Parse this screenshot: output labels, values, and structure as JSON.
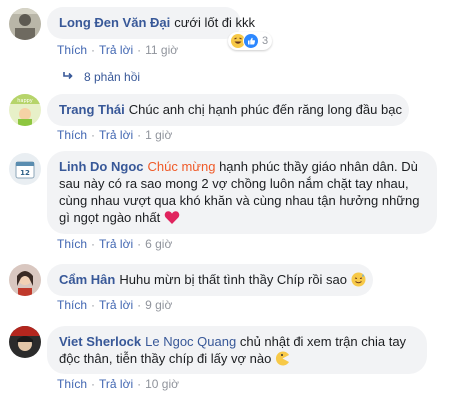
{
  "comments": [
    {
      "author": "Long Đen Văn Đại",
      "segments": [
        {
          "text": "cưới lốt đi kkk",
          "type": "plain"
        }
      ],
      "actions": {
        "like": "Thích",
        "reply": "Trả lời",
        "time": "11 giờ"
      },
      "reactions": {
        "count": "3",
        "icons": [
          "haha-icon",
          "like-icon"
        ]
      },
      "replies_label": "8 phản hồi"
    },
    {
      "author": "Trang Thái",
      "segments": [
        {
          "text": "Chúc anh chị hạnh phúc đến răng long đầu bạc",
          "type": "plain"
        }
      ],
      "actions": {
        "like": "Thích",
        "reply": "Trả lời",
        "time": "1 giờ"
      }
    },
    {
      "author": "Linh Do Ngoc",
      "mention": "Chúc mừng",
      "text_lines": [
        "hạnh phúc thầy giáo nhân dân. Dù",
        "sau này có ra sao mong 2 vợ chồng luôn nắm chặt tay nhau,",
        "cùng nhau vượt qua khó khăn và cùng nhau tận hưởng những",
        "gì ngọt ngào nhất"
      ],
      "emoji": "heart-icon",
      "actions": {
        "like": "Thích",
        "reply": "Trả lời",
        "time": "6 giờ"
      }
    },
    {
      "author": "Cẩm Hân",
      "text": "Huhu mừn bị thất tình thầy Chíp rồi sao",
      "emoji": "sweat-smile-icon",
      "actions": {
        "like": "Thích",
        "reply": "Trả lời",
        "time": "9 giờ"
      }
    },
    {
      "author": "Viet Sherlock",
      "mention": "Le Ngoc Quang",
      "text_lines": [
        "chủ nhật đi xem trận chia tay",
        "độc thân, tiễn thầy chíp đi lấy vợ nào"
      ],
      "emoji": "pacman-icon",
      "actions": {
        "like": "Thích",
        "reply": "Trả lời",
        "time": "10 giờ"
      }
    }
  ],
  "colors": {
    "author": "#385898",
    "mention_highlight": "#f05a28",
    "bubble": "#f2f3f5",
    "action_link": "#4267b2",
    "meta": "#90949c"
  }
}
